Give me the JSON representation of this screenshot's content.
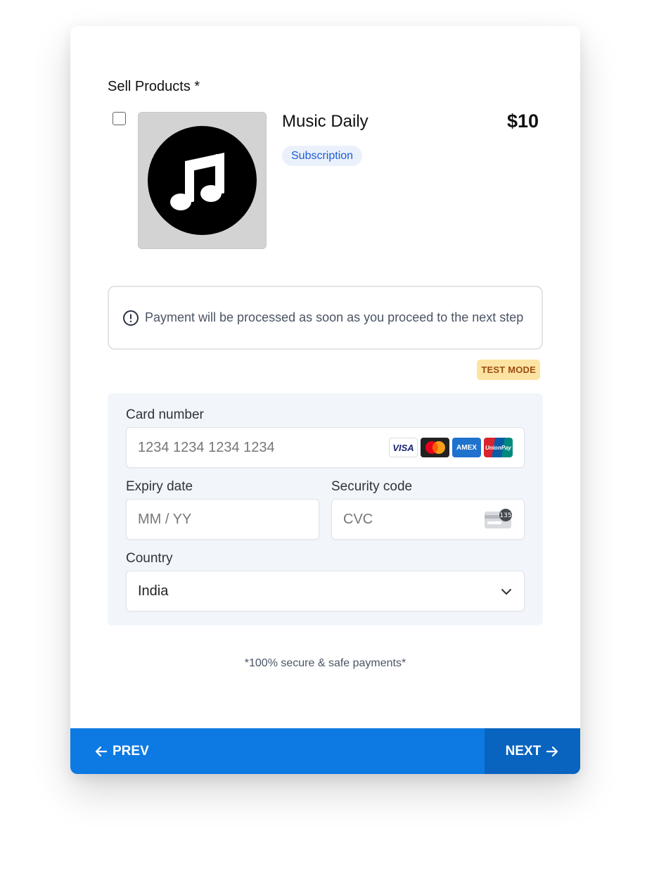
{
  "form": {
    "section_label": "Sell Products *"
  },
  "product": {
    "name": "Music Daily",
    "price": "$10",
    "badge": "Subscription",
    "selected": false,
    "image_icon": "music-note-icon"
  },
  "notice": {
    "icon": "info-circle-icon",
    "text": "Payment will be processed as soon as you proceed to the next step"
  },
  "mode_badge": "TEST MODE",
  "payment": {
    "card_number": {
      "label": "Card number",
      "placeholder": "1234 1234 1234 1234",
      "brands": [
        "VISA",
        "Mastercard",
        "AMEX",
        "UnionPay"
      ]
    },
    "expiry": {
      "label": "Expiry date",
      "placeholder": "MM / YY"
    },
    "security": {
      "label": "Security code",
      "placeholder": "CVC",
      "hint_number": "135"
    },
    "country": {
      "label": "Country",
      "value": "India"
    }
  },
  "secure_note": "*100% secure & safe payments*",
  "nav": {
    "prev_label": "PREV",
    "next_label": "NEXT"
  },
  "colors": {
    "primary": "#0d7ae3",
    "primary_dark": "#0864bf",
    "badge_text": "#1d5bd6",
    "test_mode_bg": "#fde3a2",
    "panel_bg": "#f2f6fb"
  }
}
